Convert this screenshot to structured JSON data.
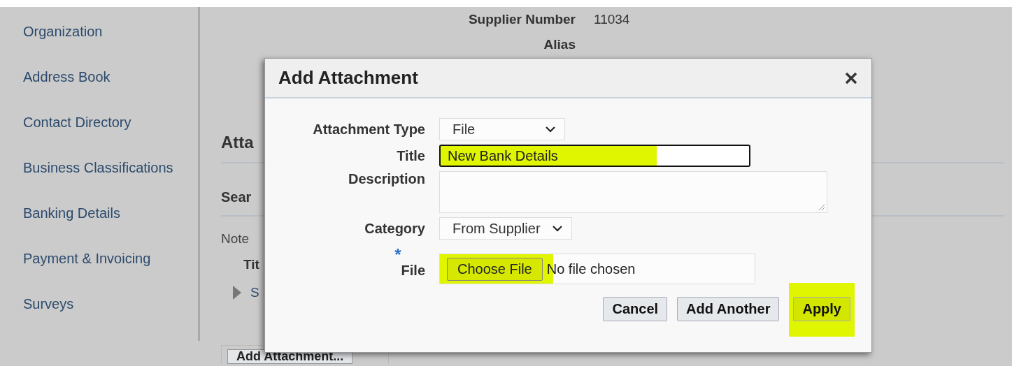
{
  "sidebar": {
    "items": [
      {
        "label": "Organization"
      },
      {
        "label": "Address Book"
      },
      {
        "label": "Contact Directory"
      },
      {
        "label": "Business Classifications"
      },
      {
        "label": "Banking Details"
      },
      {
        "label": "Payment & Invoicing"
      },
      {
        "label": "Surveys"
      }
    ]
  },
  "header": {
    "fields": [
      {
        "label": "Supplier Number",
        "value": "11034"
      },
      {
        "label": "Alias"
      }
    ]
  },
  "page": {
    "section_heading": "Atta",
    "subheading": "Sear",
    "note": "Note",
    "field_label": "Tit",
    "tree_item": "S",
    "button": "Add Attachment..."
  },
  "dialog": {
    "title": "Add Attachment",
    "fields": [
      {
        "kind": "select",
        "label": "Attachment Type",
        "value": "File"
      },
      {
        "kind": "text",
        "label": "Title",
        "value": "New Bank Details",
        "highlighted": true
      },
      {
        "kind": "textarea",
        "label": "Description"
      },
      {
        "kind": "select",
        "label": "Category",
        "value": "From Supplier"
      },
      {
        "kind": "file",
        "label": "File",
        "required_mark": "*",
        "button": "Choose File",
        "value": "No file chosen",
        "highlighted": true
      }
    ],
    "buttons": [
      {
        "label": "Cancel",
        "highlighted": false
      },
      {
        "label": "Add Another",
        "highlighted": false
      },
      {
        "label": "Apply",
        "highlighted": true
      }
    ]
  }
}
